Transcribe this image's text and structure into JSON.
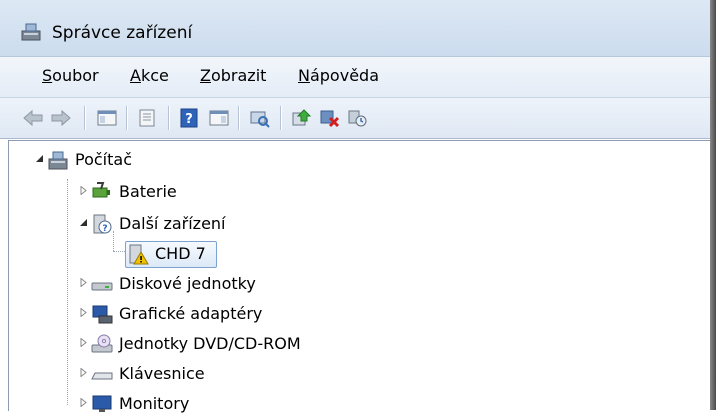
{
  "window": {
    "title": "Správce zařízení"
  },
  "menu": [
    {
      "label": "Soubor",
      "underline": "S",
      "rest": "oubor"
    },
    {
      "label": "Akce",
      "underline": "A",
      "rest": "kce"
    },
    {
      "label": "Zobrazit",
      "underline": "Z",
      "rest": "obrazit"
    },
    {
      "label": "Nápověda",
      "underline": "N",
      "rest": "ápověda"
    }
  ],
  "toolbar": {
    "icons": [
      "back-arrow-icon",
      "forward-arrow-icon",
      "show-hide-console-tree-icon",
      "properties-icon",
      "help-icon",
      "action-pane-icon",
      "scan-hardware-icon",
      "update-driver-icon",
      "disable-device-icon",
      "uninstall-device-icon"
    ]
  },
  "tree": {
    "root": "Počítač",
    "items": [
      {
        "label": "Baterie",
        "expanded": false
      },
      {
        "label": "Další zařízení",
        "expanded": true,
        "children": [
          "CHD 7"
        ]
      },
      {
        "label": "Diskové jednotky",
        "expanded": false
      },
      {
        "label": "Grafické adaptéry",
        "expanded": false
      },
      {
        "label": "Jednotky DVD/CD-ROM",
        "expanded": false
      },
      {
        "label": "Klávesnice",
        "expanded": false
      },
      {
        "label": "Monitory",
        "expanded": false
      }
    ]
  },
  "colors": {
    "selection_border": "#7da2ce",
    "warning": "#f2c200"
  }
}
